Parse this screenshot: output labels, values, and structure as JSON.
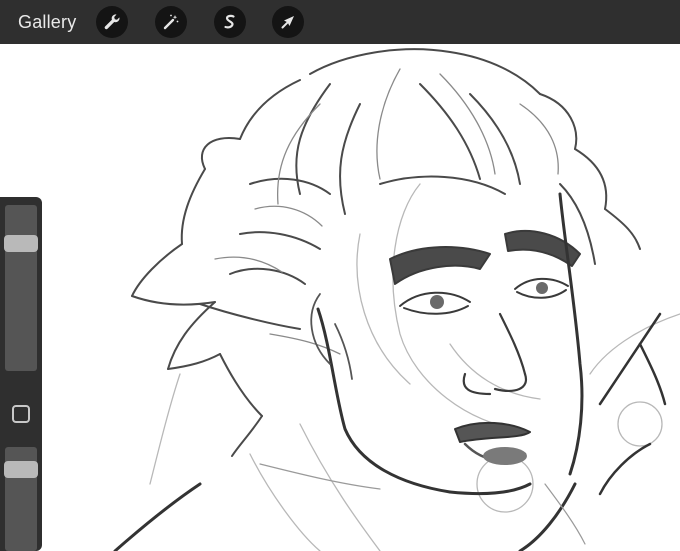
{
  "topbar": {
    "gallery_label": "Gallery",
    "tools": [
      {
        "name": "actions",
        "icon": "wrench-icon"
      },
      {
        "name": "adjustments",
        "icon": "magic-wand-icon"
      },
      {
        "name": "selection",
        "icon": "selection-s-icon"
      },
      {
        "name": "transform",
        "icon": "arrow-cursor-icon"
      }
    ]
  },
  "sidebar": {
    "brush_size_level": 0.8,
    "brush_opacity_level": 0.84
  },
  "colors": {
    "toolbar": "#2f2f2f",
    "canvas": "#ffffff",
    "ink": "#3a3a3a"
  }
}
